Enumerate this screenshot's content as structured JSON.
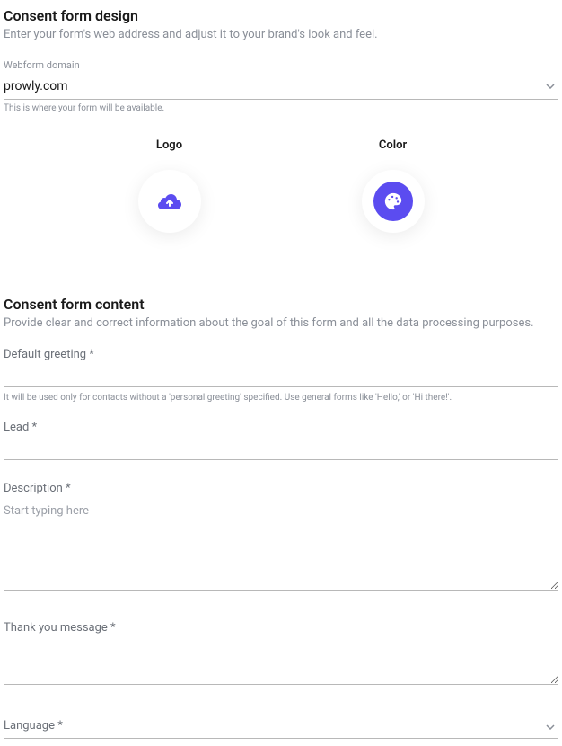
{
  "design": {
    "title": "Consent form design",
    "subtitle": "Enter your form's web address and adjust it to your brand's look and feel.",
    "domain_label": "Webform domain",
    "domain_value": "prowly.com",
    "domain_helper": "This is where your form will be available.",
    "logo_label": "Logo",
    "color_label": "Color",
    "accent_color": "#5b4cf0"
  },
  "content": {
    "title": "Consent form content",
    "subtitle": "Provide clear and correct information about the goal of this form and all the data processing purposes.",
    "greeting_label": "Default greeting *",
    "greeting_helper": "It will be used only for contacts without a 'personal greeting' specified. Use general forms like 'Hello,' or 'Hi there!'.",
    "lead_label": "Lead *",
    "description_label": "Description *",
    "description_placeholder": "Start typing here",
    "thankyou_label": "Thank you message *",
    "language_label": "Language *"
  }
}
